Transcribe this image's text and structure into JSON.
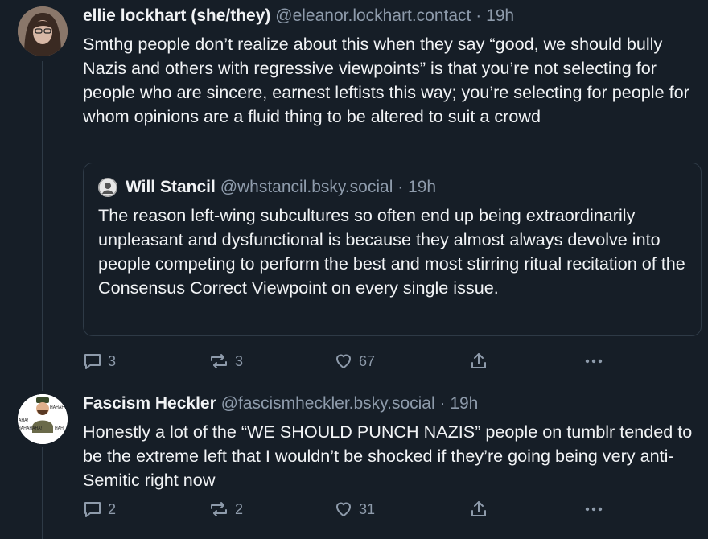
{
  "posts": [
    {
      "author_name": "ellie lockhart (she/they)",
      "handle": "@eleanor.lockhart.contact",
      "separator": "·",
      "time": "19h",
      "text": "Smthg people don’t realize about this when they say “good, we should bully Nazis and others with regressive viewpoints” is that you’re not selecting for people who are sincere, earnest leftists this way; you’re selecting for people for whom opinions are a fluid thing to be altered to suit a crowd",
      "quote": {
        "author_name": "Will Stancil",
        "handle": "@whstancil.bsky.social",
        "separator": "·",
        "time": "19h",
        "text": "The reason left-wing subcultures so often end up being extraordinarily unpleasant and dysfunctional is because they almost always devolve into people competing to perform the best and most stirring ritual recitation of the Consensus Correct Viewpoint on every single issue."
      },
      "replies": "3",
      "reposts": "3",
      "likes": "67"
    },
    {
      "author_name": "Fascism Heckler",
      "handle": "@fascismheckler.bsky.social",
      "separator": "·",
      "time": "19h",
      "text": "Honestly a lot of the “WE SHOULD PUNCH NAZIS” people on tumblr tended to be the extreme left that I wouldn’t be shocked if they’re going being very anti-Semitic right now",
      "avatar_text": [
        "HAHAH",
        "AHA!",
        "HAHAHAHA!",
        "HAH"
      ],
      "replies": "2",
      "reposts": "2",
      "likes": "31"
    }
  ],
  "colors": {
    "background": "#161e27",
    "text": "#f1f3f5",
    "muted": "#8e9bab",
    "border": "#2e3a46"
  },
  "icons": [
    "reply-icon",
    "repost-icon",
    "like-icon",
    "share-icon",
    "more-icon"
  ]
}
